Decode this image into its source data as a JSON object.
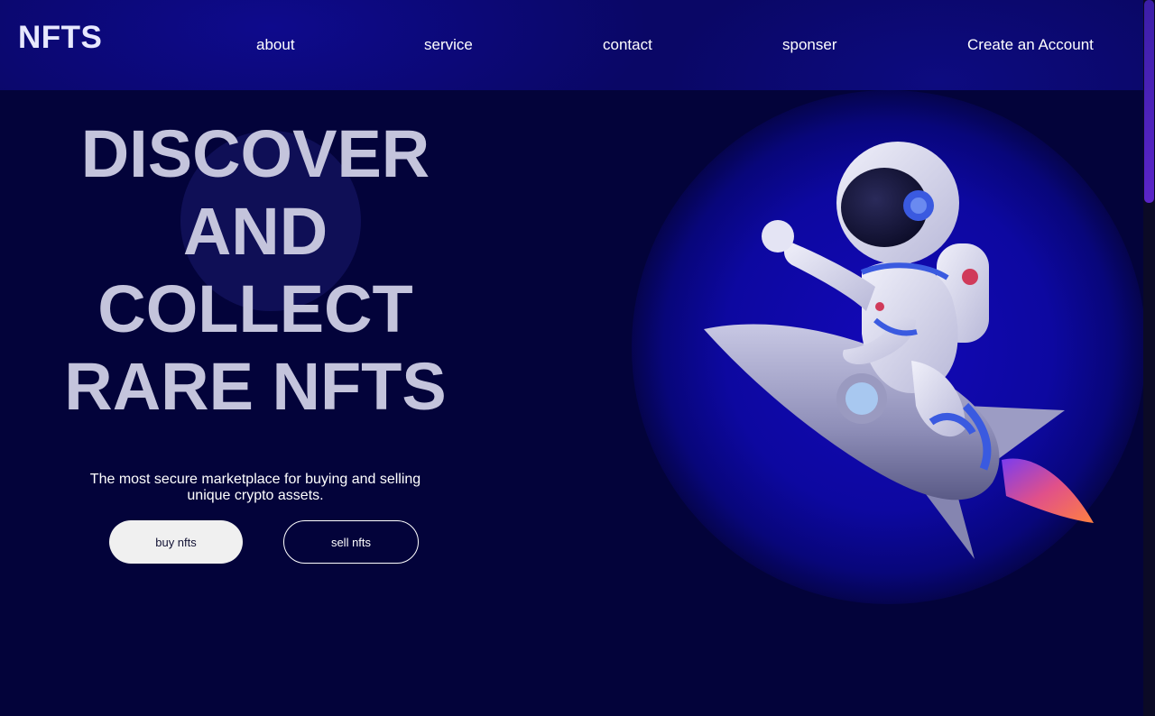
{
  "header": {
    "logo": "NFTS",
    "nav": {
      "about": "about",
      "service": "service",
      "contact": "contact",
      "sponser": "sponser",
      "create_account": "Create an Account"
    }
  },
  "hero": {
    "title_lines": [
      "DISCOVER",
      "AND",
      "COLLECT",
      "RARE NFTS"
    ],
    "subtitle": "The most secure marketplace for buying and selling unique crypto assets.",
    "buy_button": "buy nfts",
    "sell_button": "sell nfts"
  },
  "illustration": "astronaut-riding-rocket",
  "colors": {
    "header_bg": "#0a0766",
    "page_bg": "#03033a",
    "title": "#c4c4dc",
    "glow": "#1308b8",
    "buy_button_bg": "#f0f0f0"
  }
}
